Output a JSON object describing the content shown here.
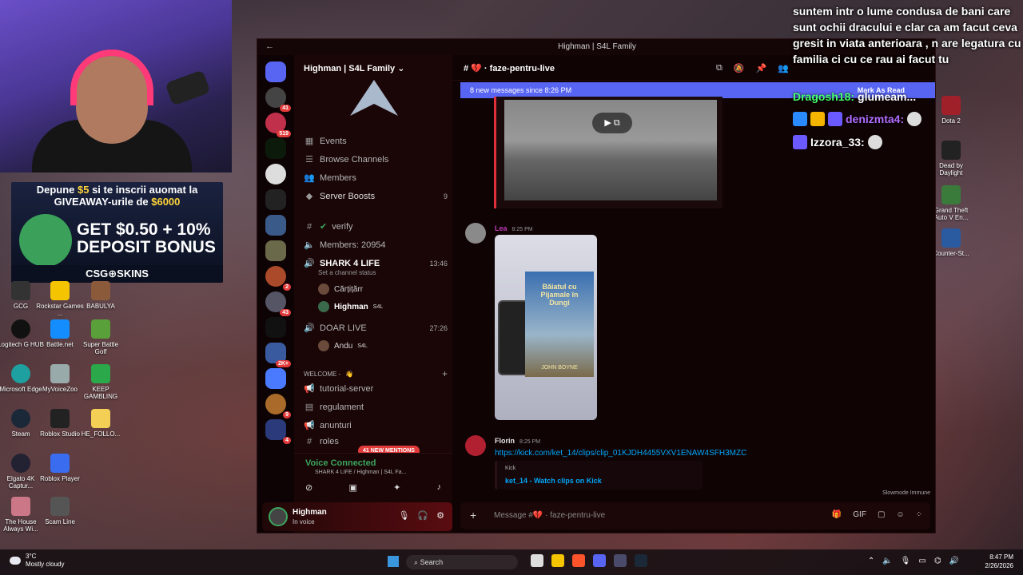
{
  "overlay": {
    "message": "suntem intr o lume condusa de bani care sunt ochii dracului e clar ca am facut ceva gresit in viata anterioara , n are legatura cu familia ci cu ce rau ai facut tu",
    "chat": [
      {
        "user": "Dragosh18:",
        "text": "glumeam...",
        "color": "#45ff6e"
      },
      {
        "user": "denizmta4:",
        "text": "",
        "color": "#b06cff"
      },
      {
        "user": "Izzora_33:",
        "text": "",
        "color": "#ffffff"
      }
    ]
  },
  "ad": {
    "line1_pre": "Depune ",
    "line1_amt": "$5",
    "line1_post": " si te inscrii auomat la",
    "line2_pre": "GIVEAWAY-urile de ",
    "line2_amt": "$6000",
    "big1": "GET $0.50 + 10%",
    "big2": "DEPOSIT BONUS",
    "brand": "CSG⊕SKINS"
  },
  "desktop_left": [
    {
      "label": "GCG"
    },
    {
      "label": "Rockstar Games ..."
    },
    {
      "label": "BABULYA"
    },
    {
      "label": "Logitech G HUB"
    },
    {
      "label": "Battle.net"
    },
    {
      "label": "Super Battle Golf"
    },
    {
      "label": "Microsoft Edge"
    },
    {
      "label": "MyVoiceZoo"
    },
    {
      "label": "KEEP GAMBLING"
    },
    {
      "label": "Steam"
    },
    {
      "label": "Roblox Studio"
    },
    {
      "label": "HE_FOLLO..."
    },
    {
      "label": "Elgato 4K Captur..."
    },
    {
      "label": "Roblox Player"
    },
    {
      "label": "The House Always Wi..."
    },
    {
      "label": "Scam Line"
    }
  ],
  "desktop_right": [
    {
      "label": "Dota 2"
    },
    {
      "label": "Dead by Daylight"
    },
    {
      "label": "Grand Theft Auto V En..."
    },
    {
      "label": "Counter-St..."
    }
  ],
  "discord": {
    "title": "Highman | S4L Family",
    "server_name": "Highman | S4L Family",
    "server_badges": [
      "41",
      "519",
      "2",
      "43",
      "2K+",
      "9",
      "4"
    ],
    "nav": [
      {
        "label": "Events",
        "badge": ""
      },
      {
        "label": "Browse Channels",
        "badge": ""
      },
      {
        "label": "Members",
        "badge": ""
      },
      {
        "label": "Server Boosts",
        "badge": "9"
      }
    ],
    "channels": {
      "verify": "verify",
      "members": "Members: 20954",
      "shark": "SHARK 4 LIFE",
      "shark_time": "13:46",
      "status": "Set a channel status",
      "user1": "Cărțițărr",
      "user2": "Highman",
      "user2_tag": "S4L",
      "doar": "DOAR LIVE",
      "doar_time": "27:26",
      "user3": "Andu",
      "user3_tag": "S4L",
      "category": "WELCOME -",
      "tutorial": "tutorial-server",
      "regulament": "regulament",
      "anunturi": "anunturi",
      "roles": "roles",
      "mentions": "41 NEW MENTIONS"
    },
    "voice": {
      "connected": "Voice Connected",
      "sub": "SHARK 4 LIFE / Highman | S4L Fa..."
    },
    "user": {
      "name": "Highman",
      "status": "In voice"
    },
    "channel_name": "faze-pentru-live",
    "header_search": "Search Highman | S4L Family",
    "new_messages": "8 new messages since 8:26 PM",
    "mark_read": "Mark As Read",
    "messages": [
      {
        "author": "Lea",
        "time": "8:25 PM",
        "color": "#c13cb8"
      },
      {
        "author": "Florin",
        "time": "8:25 PM",
        "color": "#e6e6e6",
        "link": "https://kick.com/ket_14/clips/clip_01KJDH4455VXV1ENAW4SFH3MZC",
        "embed_provider": "Kick",
        "embed_title": "ket_14 - Watch clips on Kick"
      }
    ],
    "book_title": "Băiatul cu Pijamale în Dungi",
    "book_author": "JOHN BOYNE",
    "slowmode": "Slowmode Immune",
    "composer_placeholder": "Message #💔 · faze-pentru-live"
  },
  "taskbar": {
    "temp": "3°C",
    "weather": "Mostly cloudy",
    "search": "Search",
    "time": "8:47 PM",
    "date": "2/26/2026"
  }
}
